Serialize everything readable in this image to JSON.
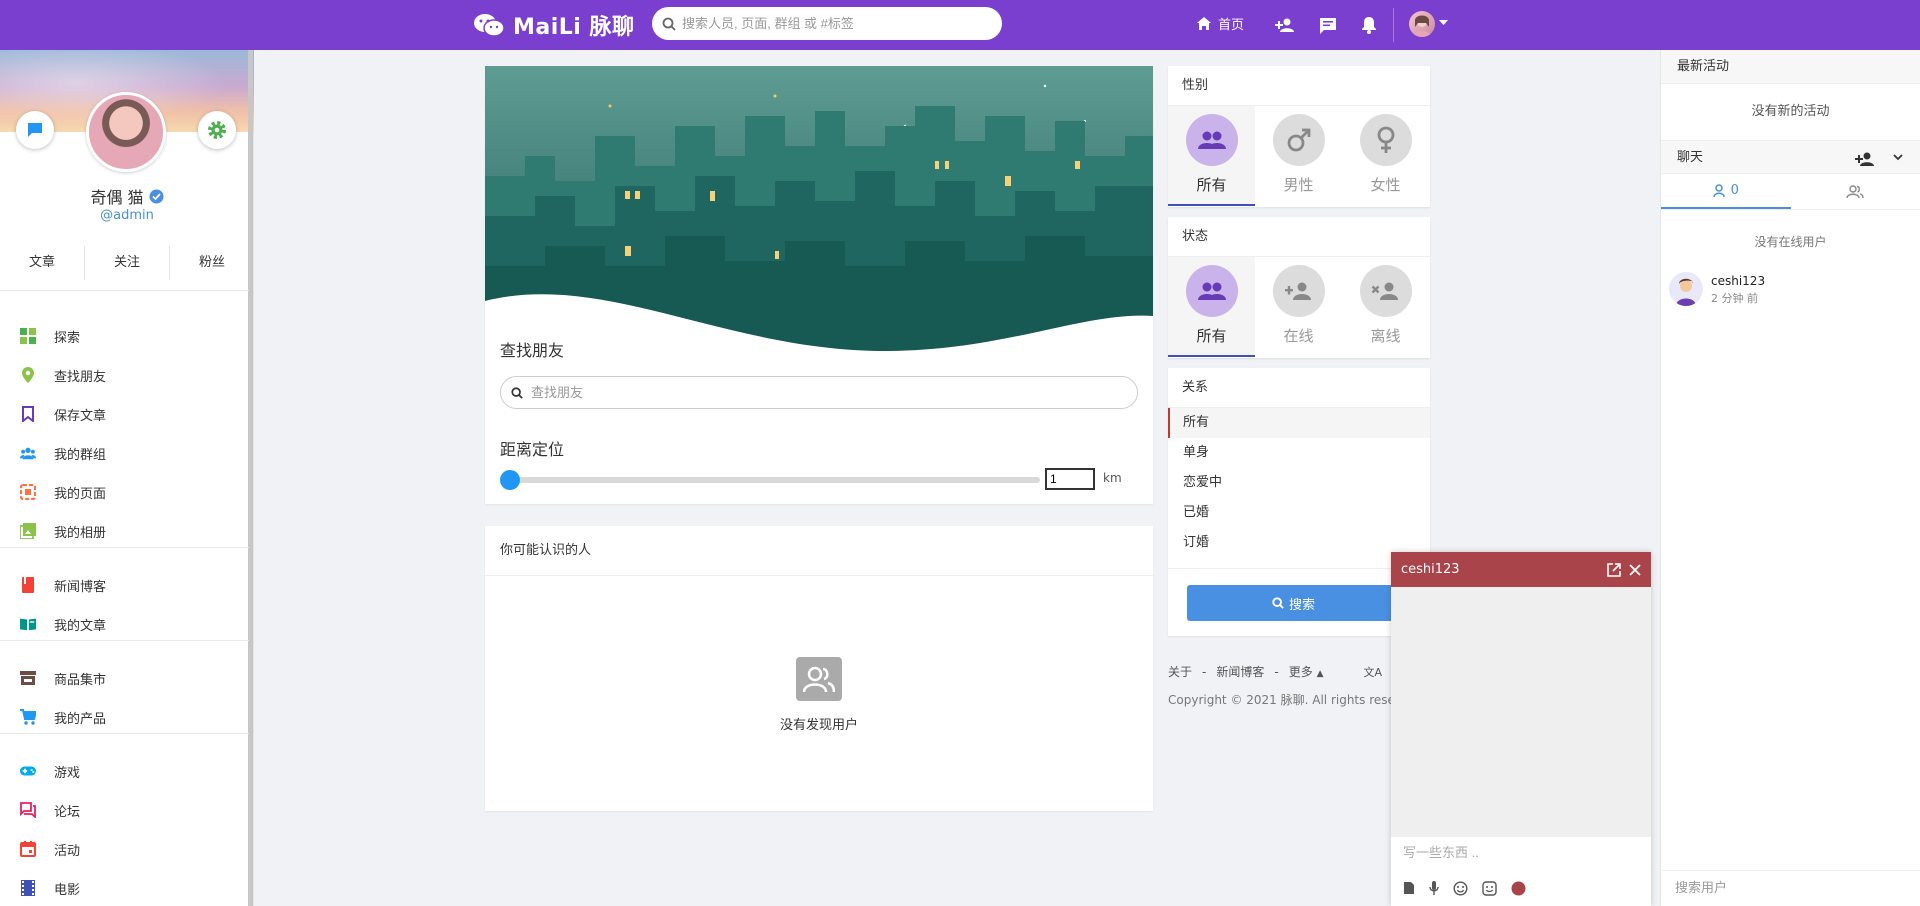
{
  "header": {
    "logo_text": "MaiLi 脉聊",
    "search_placeholder": "搜索人员, 页面, 群组 或 #标签",
    "home_label": "首页"
  },
  "profile": {
    "name": "奇偶 猫",
    "handle": "@admin",
    "stats": [
      "文章",
      "关注",
      "粉丝"
    ]
  },
  "sidebar": {
    "items": [
      {
        "label": "探索",
        "color": "#4caf50"
      },
      {
        "label": "查找朋友",
        "color": "#8bc34a"
      },
      {
        "label": "保存文章",
        "color": "#673ab7"
      },
      {
        "label": "我的群组",
        "color": "#2196f3"
      },
      {
        "label": "我的页面",
        "color": "#ff7043"
      },
      {
        "label": "我的相册",
        "color": "#8bc34a"
      },
      {
        "label": "新闻博客",
        "color": "#f44336"
      },
      {
        "label": "我的文章",
        "color": "#009688"
      },
      {
        "label": "商品集市",
        "color": "#6d4c41"
      },
      {
        "label": "我的产品",
        "color": "#2196f3"
      },
      {
        "label": "游戏",
        "color": "#03a9f4"
      },
      {
        "label": "论坛",
        "color": "#e91e63"
      },
      {
        "label": "活动",
        "color": "#f44336"
      },
      {
        "label": "电影",
        "color": "#3f51b5"
      }
    ]
  },
  "main": {
    "find_friends_title": "查找朋友",
    "find_friends_placeholder": "查找朋友",
    "distance_title": "距离定位",
    "distance_value": "1",
    "distance_unit": "km",
    "people_title": "你可能认识的人",
    "no_users_text": "没有发现用户"
  },
  "filters": {
    "gender": {
      "title": "性别",
      "options": [
        "所有",
        "男性",
        "女性"
      ],
      "selected": "所有"
    },
    "status": {
      "title": "状态",
      "options": [
        "所有",
        "在线",
        "离线"
      ],
      "selected": "所有"
    },
    "relation": {
      "title": "关系",
      "options": [
        "所有",
        "单身",
        "恋爱中",
        "已婚",
        "订婚"
      ],
      "selected": "所有"
    },
    "search_button": "搜索"
  },
  "footer": {
    "links": [
      "关于",
      "-",
      "新闻博客",
      "-",
      "更多"
    ],
    "copyright": "Copyright © 2021 脉聊. All rights reserved"
  },
  "right_panel": {
    "activity_title": "最新活动",
    "no_activity": "没有新的活动",
    "chat_title": "聊天",
    "tab_online_count": "0",
    "no_online": "没有在线用户",
    "user_name": "ceshi123",
    "user_time": "2 分钟 前",
    "search_placeholder": "搜索用户"
  },
  "chat_window": {
    "title": "ceshi123",
    "input_placeholder": "写一些东西 ..",
    "header_color": "#a8444a"
  },
  "colors": {
    "brand": "#7b3fd0",
    "accent": "#2196f3",
    "active_filter": "#c9b3ea"
  }
}
